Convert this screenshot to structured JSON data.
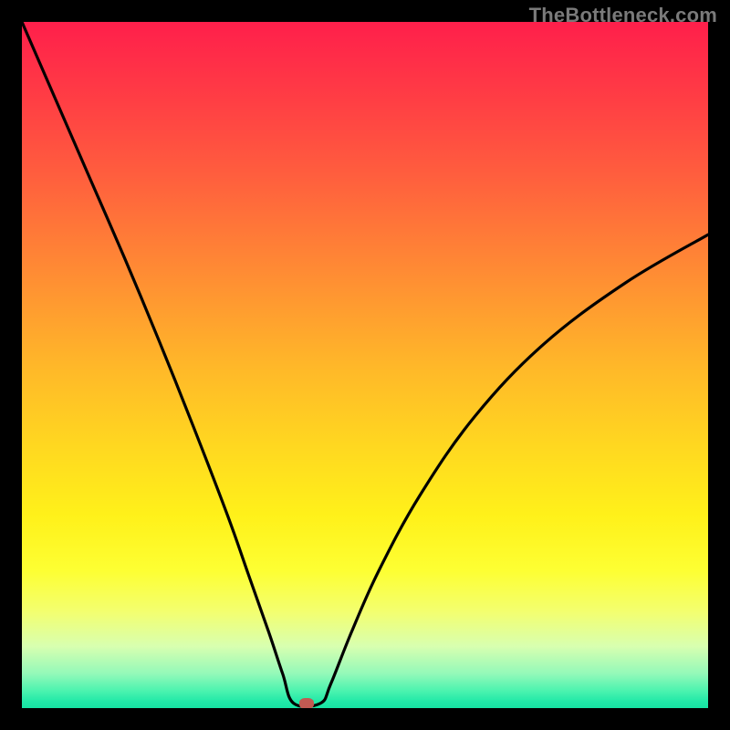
{
  "watermark": "TheBottleneck.com",
  "chart_data": {
    "type": "line",
    "title": "",
    "xlabel": "",
    "ylabel": "",
    "xlim": [
      0,
      100
    ],
    "ylim": [
      0,
      100
    ],
    "grid": false,
    "legend": false,
    "background": "black-border-with-red-to-green-vertical-gradient",
    "series": [
      {
        "name": "bottleneck-curve",
        "x": [
          0,
          5,
          10,
          15,
          20,
          25,
          30,
          33,
          36,
          38,
          39.6,
          43.5,
          45,
          48,
          52,
          58,
          66,
          76,
          88,
          100
        ],
        "y": [
          100,
          88.5,
          77,
          65.5,
          53.5,
          41,
          28,
          19.5,
          11,
          5,
          0.7,
          0.7,
          3.5,
          11,
          20,
          31,
          42.5,
          53,
          62,
          69
        ],
        "color": "#000000",
        "stroke_width": 3
      }
    ],
    "markers": [
      {
        "name": "current-point",
        "x": 41.5,
        "y": 0.6,
        "color": "#c15a52"
      }
    ]
  }
}
